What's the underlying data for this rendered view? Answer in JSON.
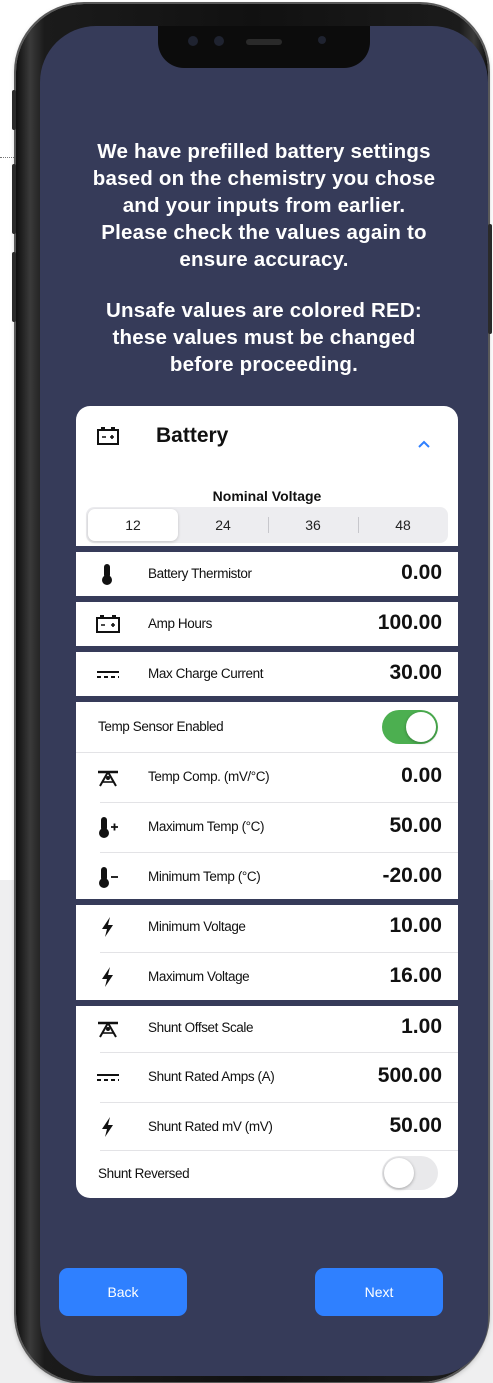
{
  "intro": {
    "line1": "We have prefilled battery settings",
    "line2": "based on the chemistry you chose",
    "line3": "and your inputs from earlier.",
    "line4": "Please check the values again to",
    "line5": "ensure accuracy.",
    "line6": "Unsafe values are colored RED:",
    "line7": "these values must be changed",
    "line8": "before proceeding."
  },
  "card": {
    "title": "Battery",
    "nominal_voltage_label": "Nominal Voltage",
    "voltage_options": [
      "12",
      "24",
      "36",
      "48"
    ],
    "selected_voltage": "12",
    "rows": {
      "battery_thermistor": {
        "label": "Battery Thermistor",
        "value": "0.00"
      },
      "amp_hours": {
        "label": "Amp Hours",
        "value": "100.00"
      },
      "max_charge_current": {
        "label": "Max Charge Current",
        "value": "30.00"
      },
      "temp_sensor_enabled": {
        "label": "Temp Sensor Enabled"
      },
      "temp_comp": {
        "label": "Temp Comp. (mV/°C)",
        "value": "0.00"
      },
      "maximum_temp": {
        "label": "Maximum Temp (°C)",
        "value": "50.00"
      },
      "minimum_temp": {
        "label": "Minimum Temp (°C)",
        "value": "-20.00"
      },
      "minimum_voltage": {
        "label": "Minimum Voltage",
        "value": "10.00"
      },
      "maximum_voltage": {
        "label": "Maximum Voltage",
        "value": "16.00"
      },
      "shunt_offset_scale": {
        "label": "Shunt Offset Scale",
        "value": "1.00"
      },
      "shunt_rated_amps": {
        "label": "Shunt Rated Amps (A)",
        "value": "500.00"
      },
      "shunt_rated_mv": {
        "label": "Shunt Rated mV (mV)",
        "value": "50.00"
      },
      "shunt_reversed": {
        "label": "Shunt Reversed"
      }
    }
  },
  "toggles": {
    "temp_sensor_enabled": true,
    "shunt_reversed": false
  },
  "buttons": {
    "back": "Back",
    "next": "Next"
  },
  "colors": {
    "screen_bg": "#363b59",
    "accent": "#2f80ff",
    "toggle_on": "#4caf50",
    "chevron": "#2f80ff"
  },
  "icons": {
    "header": "battery-icon",
    "battery_thermistor": "thermometer-icon",
    "amp_hours": "battery-icon",
    "max_charge_current": "dc-current-icon",
    "temp_comp": "temp-comp-icon",
    "maximum_temp": "thermometer-plus-icon",
    "minimum_temp": "thermometer-minus-icon",
    "minimum_voltage": "lightning-icon",
    "maximum_voltage": "lightning-icon",
    "shunt_offset_scale": "temp-comp-icon",
    "shunt_rated_amps": "dc-current-icon",
    "shunt_rated_mv": "lightning-icon",
    "collapse": "chevron-up-icon"
  }
}
